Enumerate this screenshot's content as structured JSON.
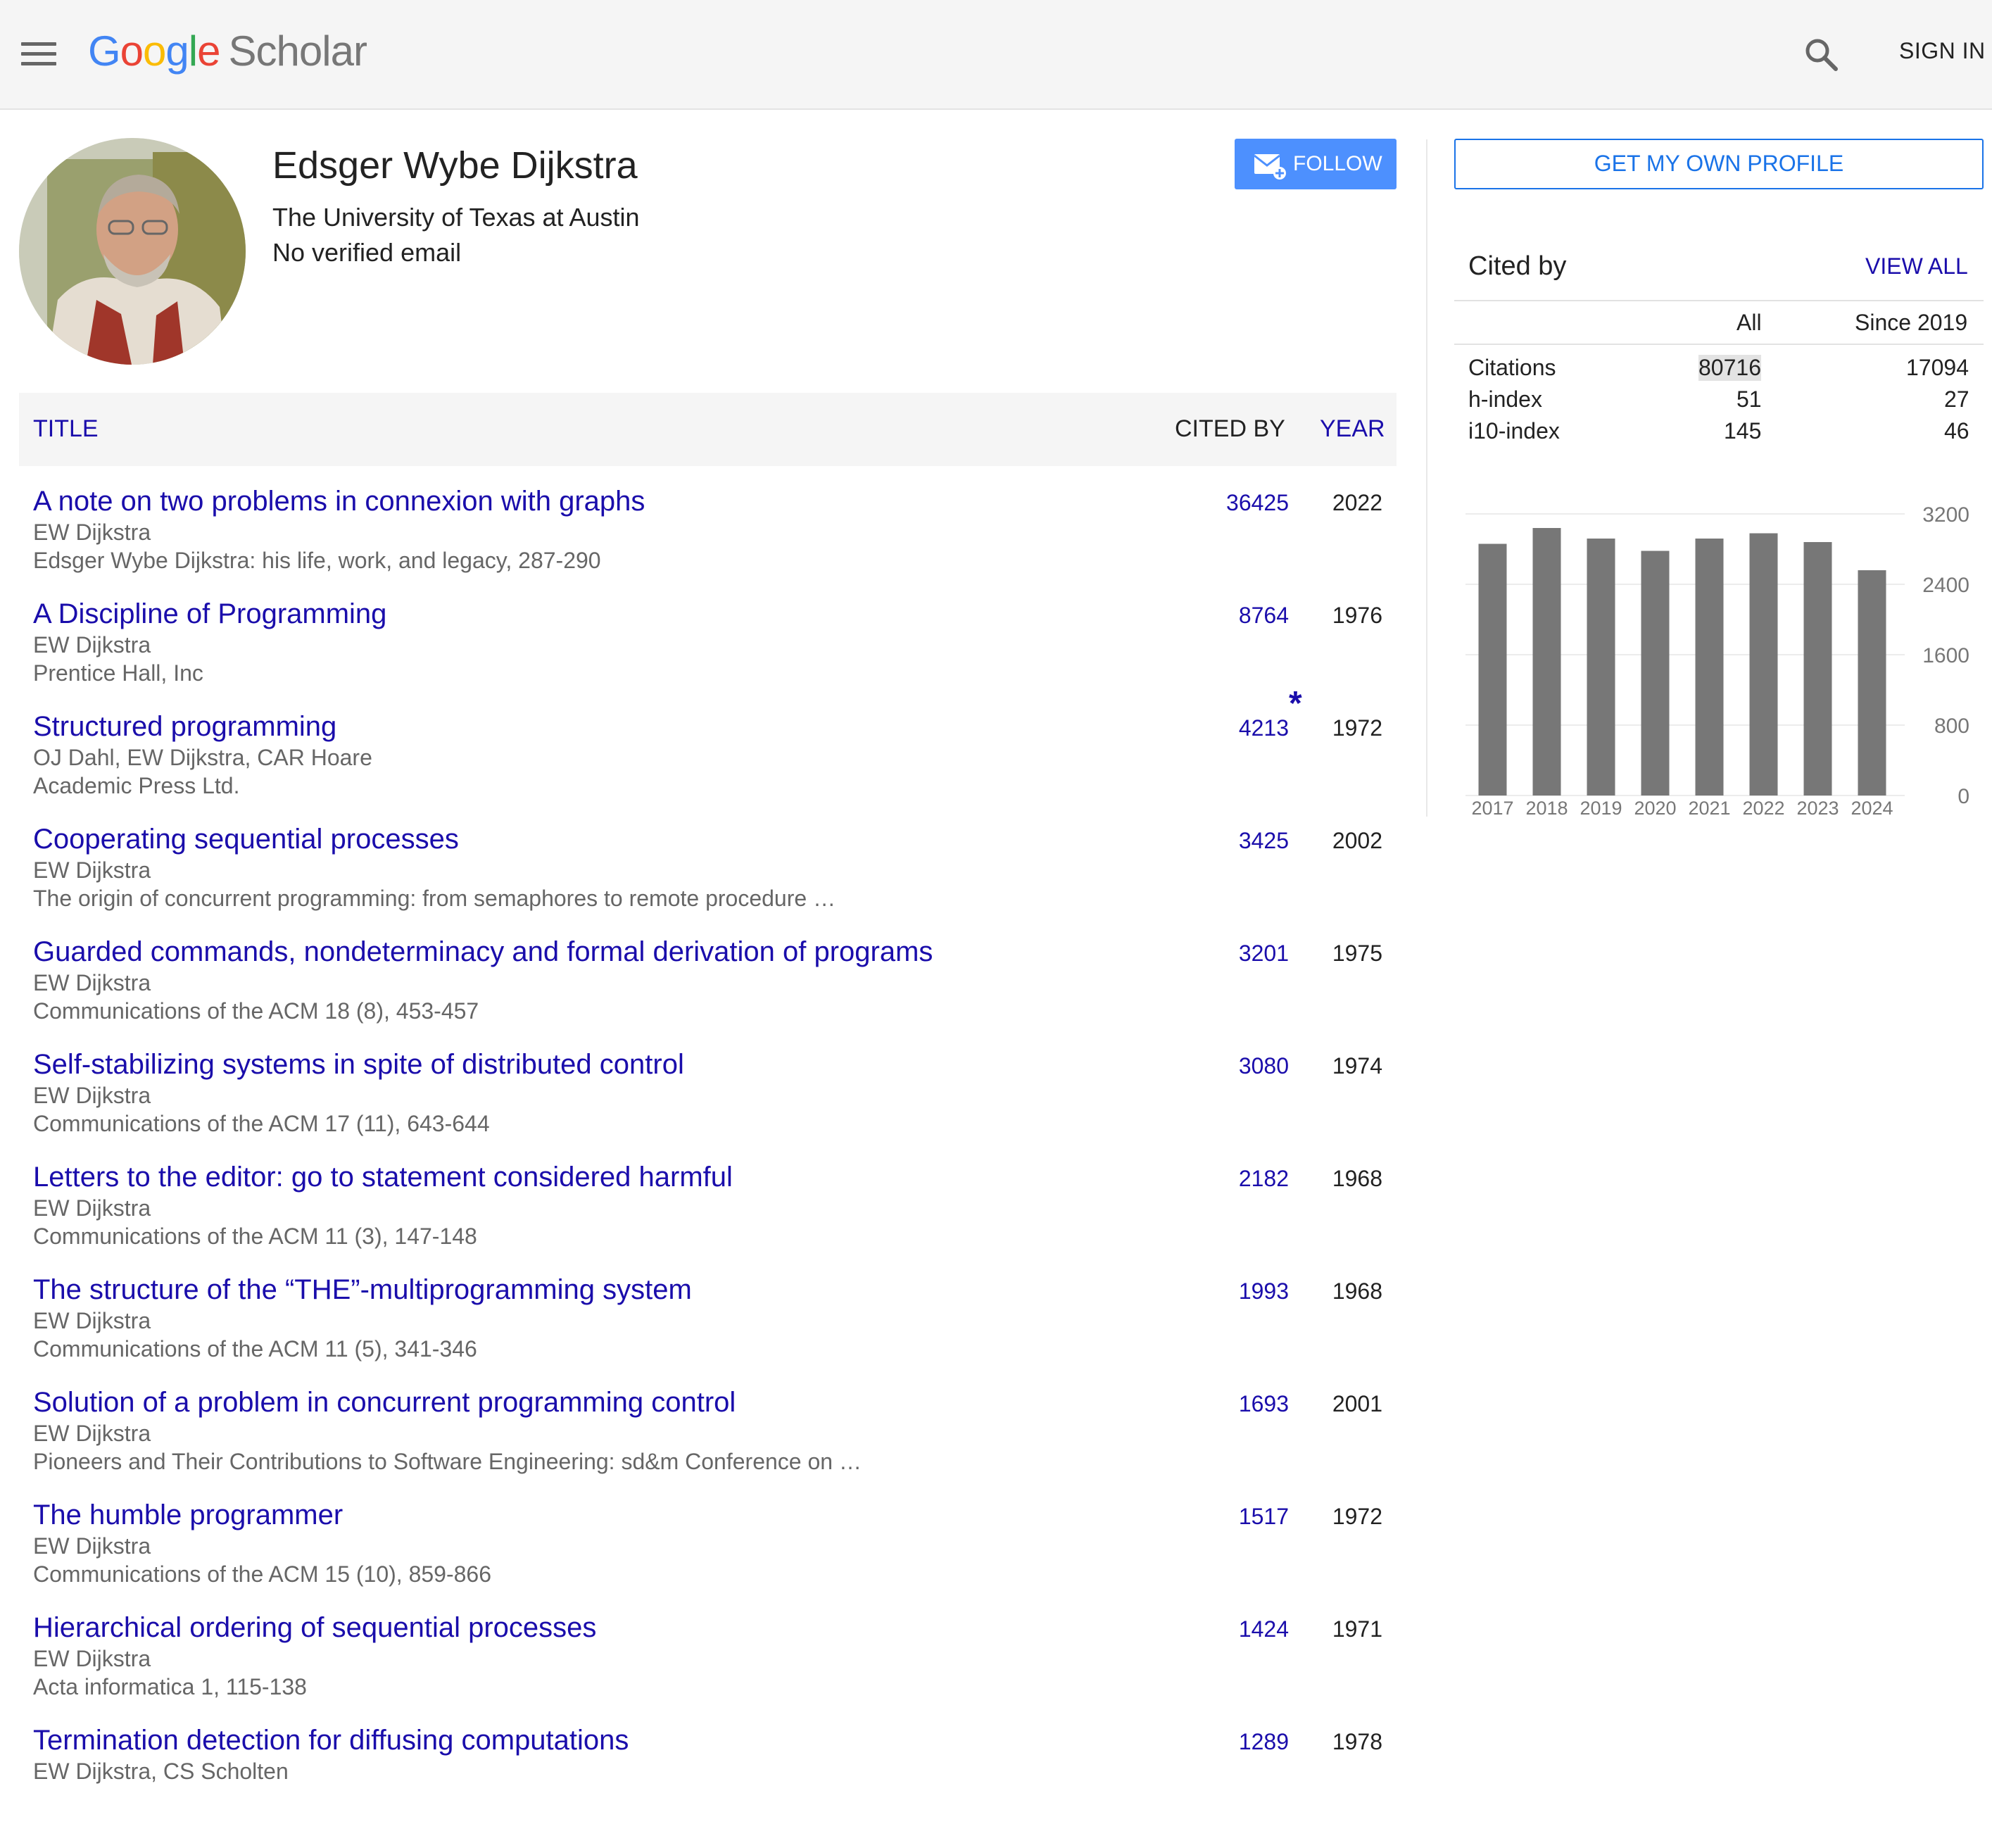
{
  "header": {
    "logo_letters": [
      "G",
      "o",
      "o",
      "g",
      "l",
      "e"
    ],
    "logo_word": "Scholar",
    "signin_label": "SIGN IN"
  },
  "profile": {
    "name": "Edsger Wybe Dijkstra",
    "affiliation": "The University of Texas at Austin",
    "email": "No verified email",
    "follow_label": "FOLLOW",
    "own_profile_label": "GET MY OWN PROFILE"
  },
  "table": {
    "title_header": "TITLE",
    "cited_header": "CITED BY",
    "year_header": "YEAR",
    "rows": [
      {
        "title": "A note on two problems in connexion with graphs",
        "authors": "EW Dijkstra",
        "venue": "Edsger Wybe Dijkstra: his life, work, and legacy, 287-290",
        "cites": "36425",
        "year": "2022"
      },
      {
        "title": "A Discipline of Programming",
        "authors": "EW Dijkstra",
        "venue": "Prentice Hall, Inc",
        "cites": "8764",
        "year": "1976"
      },
      {
        "title": "Structured programming",
        "authors": "OJ Dahl, EW Dijkstra, CAR Hoare",
        "venue": "Academic Press Ltd.",
        "cites": "4213",
        "year": "1972",
        "star": "*"
      },
      {
        "title": "Cooperating sequential processes",
        "authors": "EW Dijkstra",
        "venue": "The origin of concurrent programming: from semaphores to remote procedure …",
        "cites": "3425",
        "year": "2002"
      },
      {
        "title": "Guarded commands, nondeterminacy and formal derivation of programs",
        "authors": "EW Dijkstra",
        "venue": "Communications of the ACM 18 (8), 453-457",
        "cites": "3201",
        "year": "1975"
      },
      {
        "title": "Self-stabilizing systems in spite of distributed control",
        "authors": "EW Dijkstra",
        "venue": "Communications of the ACM 17 (11), 643-644",
        "cites": "3080",
        "year": "1974"
      },
      {
        "title": "Letters to the editor: go to statement considered harmful",
        "authors": "EW Dijkstra",
        "venue": "Communications of the ACM 11 (3), 147-148",
        "cites": "2182",
        "year": "1968"
      },
      {
        "title": "The structure of the “THE”-multiprogramming system",
        "authors": "EW Dijkstra",
        "venue": "Communications of the ACM 11 (5), 341-346",
        "cites": "1993",
        "year": "1968"
      },
      {
        "title": "Solution of a problem in concurrent programming control",
        "authors": "EW Dijkstra",
        "venue": "Pioneers and Their Contributions to Software Engineering: sd&m Conference on …",
        "cites": "1693",
        "year": "2001"
      },
      {
        "title": "The humble programmer",
        "authors": "EW Dijkstra",
        "venue": "Communications of the ACM 15 (10), 859-866",
        "cites": "1517",
        "year": "1972"
      },
      {
        "title": "Hierarchical ordering of sequential processes",
        "authors": "EW Dijkstra",
        "venue": "Acta informatica 1, 115-138",
        "cites": "1424",
        "year": "1971"
      },
      {
        "title": "Termination detection for diffusing computations",
        "authors": "EW Dijkstra, CS Scholten",
        "venue": "",
        "cites": "1289",
        "year": "1978"
      }
    ]
  },
  "cited_by": {
    "title": "Cited by",
    "view_all": "VIEW ALL",
    "col_all": "All",
    "col_since": "Since 2019",
    "rows": [
      {
        "label": "Citations",
        "all": "80716",
        "since": "17094"
      },
      {
        "label": "h-index",
        "all": "51",
        "since": "27"
      },
      {
        "label": "i10-index",
        "all": "145",
        "since": "46"
      }
    ]
  },
  "chart_data": {
    "type": "bar",
    "categories": [
      "2017",
      "2018",
      "2019",
      "2020",
      "2021",
      "2022",
      "2023",
      "2024"
    ],
    "values": [
      2860,
      3040,
      2920,
      2780,
      2920,
      2980,
      2880,
      2560
    ],
    "ylim": [
      0,
      3200
    ],
    "yticks": [
      "3200",
      "2400",
      "1600",
      "800",
      "0"
    ],
    "grid": true,
    "bar_color": "#777777"
  }
}
